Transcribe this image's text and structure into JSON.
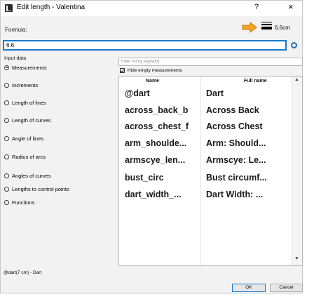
{
  "window": {
    "title": "Edit length - Valentina",
    "help": "?",
    "close": "×"
  },
  "formula": {
    "label": "Formula:",
    "value": "6.6",
    "line_width": "6.6cm"
  },
  "input_data": {
    "label": "Input data",
    "options": [
      {
        "label": "Measurements",
        "selected": true
      },
      {
        "label": "Increments",
        "selected": false
      },
      {
        "label": "Length of lines",
        "selected": false
      },
      {
        "label": "Length of curves",
        "selected": false
      },
      {
        "label": "Angle of lines",
        "selected": false
      },
      {
        "label": "Radius of arcs",
        "selected": false
      },
      {
        "label": "Angles of curves",
        "selected": false
      },
      {
        "label": "Lengths to control points",
        "selected": false
      },
      {
        "label": "Functions",
        "selected": false
      }
    ]
  },
  "filter": {
    "placeholder": "Filter list by keyword"
  },
  "hide_empty": {
    "label": "Hide empty measurements",
    "checked": true
  },
  "table": {
    "headers": {
      "name": "Name",
      "full_name": "Full name"
    },
    "rows": [
      {
        "name": "@dart",
        "full_name": "Dart"
      },
      {
        "name": "across_back_b",
        "full_name": "Across Back"
      },
      {
        "name": "across_chest_f",
        "full_name": "Across Chest"
      },
      {
        "name": "arm_shoulde...",
        "full_name": "Arm: Should..."
      },
      {
        "name": "armscye_len...",
        "full_name": "Armscye: Le..."
      },
      {
        "name": "bust_circ",
        "full_name": "Bust circumf..."
      },
      {
        "name": "dart_width_...",
        "full_name": "Dart Width: ..."
      }
    ]
  },
  "description": "@dart(7 cm) - Dart",
  "buttons": {
    "ok": "OK",
    "cancel": "Cancel"
  },
  "colors": {
    "accent": "#1979ca",
    "window_bg": "#f2f2f2",
    "hand_icon": "#f5a623"
  },
  "icons": {
    "app": "valentina-app-icon",
    "hand": "pointing-hand-icon",
    "length": "line-width-icon",
    "gear": "gear-icon"
  }
}
